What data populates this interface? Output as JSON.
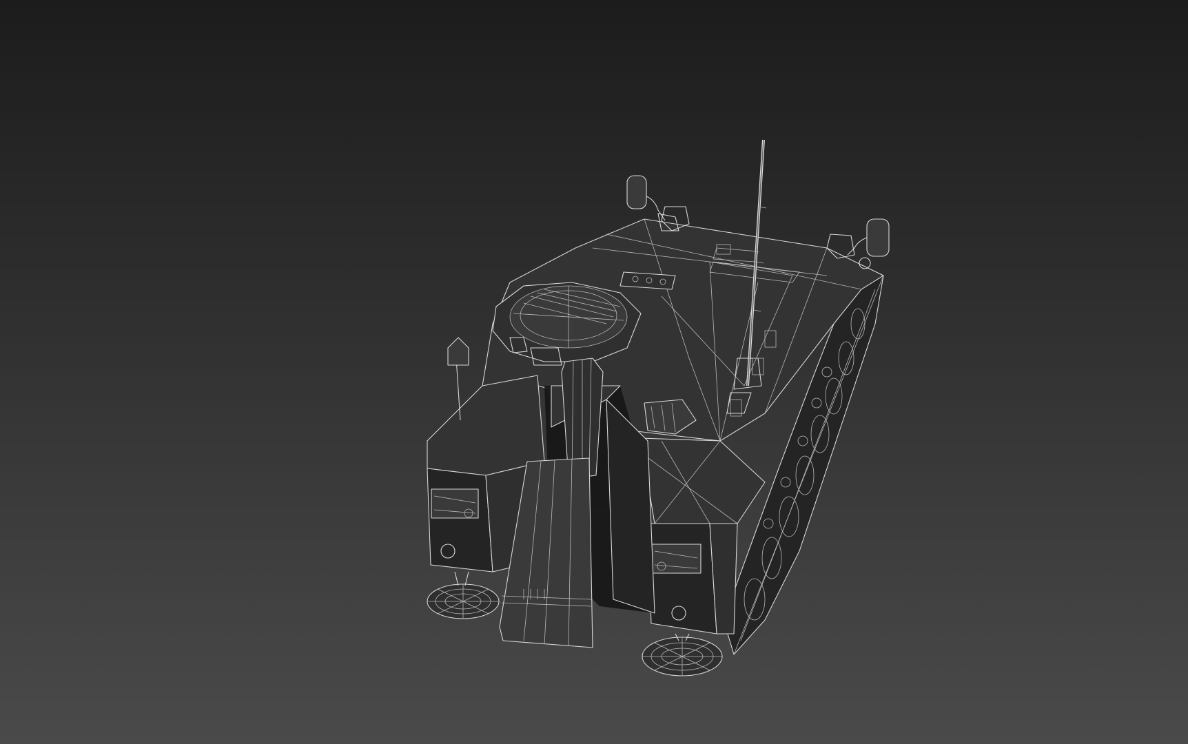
{
  "viewport": {
    "background_top": "#1c1c1c",
    "background_bottom": "#4a4a4a",
    "wire_color": "#d8d8d8"
  },
  "scene": {
    "object": "tracked-armored-vehicle",
    "display_mode": "wireframe-over-shaded"
  }
}
